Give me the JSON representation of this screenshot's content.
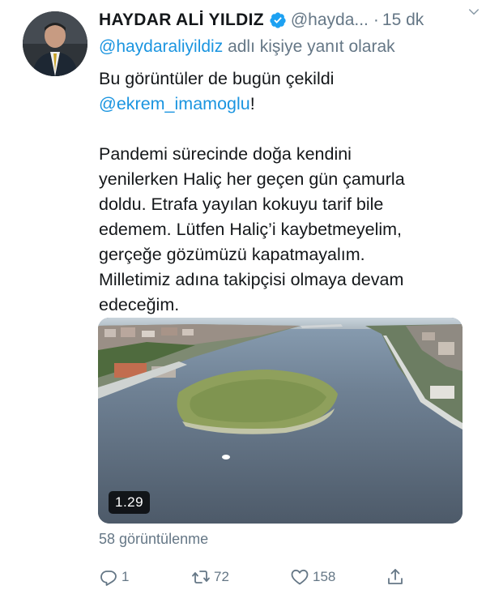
{
  "author": {
    "display_name": "HAYDAR ALİ YILDIZ",
    "handle": "@hayda...",
    "separator": "·",
    "time": "15 dk",
    "verified": true,
    "avatar_icon": "profile-photo"
  },
  "reply": {
    "handle": "@haydaraliyildiz",
    "text": "adlı kişiye yanıt olarak"
  },
  "tweet": {
    "line1": "Bu görüntüler de bugün çekildi",
    "mention": "@ekrem_imamoglu",
    "mention_suffix": "!",
    "paragraph2": [
      "Pandemi sürecinde doğa kendini",
      "yenilerken Haliç her geçen gün çamurla",
      "doldu. Etrafa yayılan kokuyu tarif bile",
      "edemem. Lütfen Haliç’i kaybetmeyelim,",
      "gerçeğe gözümüzü kapatmayalım.",
      "Milletimiz adına takipçisi olmaya devam",
      "edeceğim."
    ]
  },
  "media": {
    "type": "video",
    "duration": "1.29"
  },
  "views": "58 görüntülenme",
  "actions": {
    "reply_count": "1",
    "retweet_count": "72",
    "like_count": "158",
    "reply_icon": "reply-icon",
    "retweet_icon": "retweet-icon",
    "like_icon": "heart-icon",
    "share_icon": "share-icon"
  },
  "colors": {
    "link": "#1b95e0",
    "secondary_text": "#657786",
    "primary_text": "#14171a",
    "verified": "#1da1f2"
  }
}
